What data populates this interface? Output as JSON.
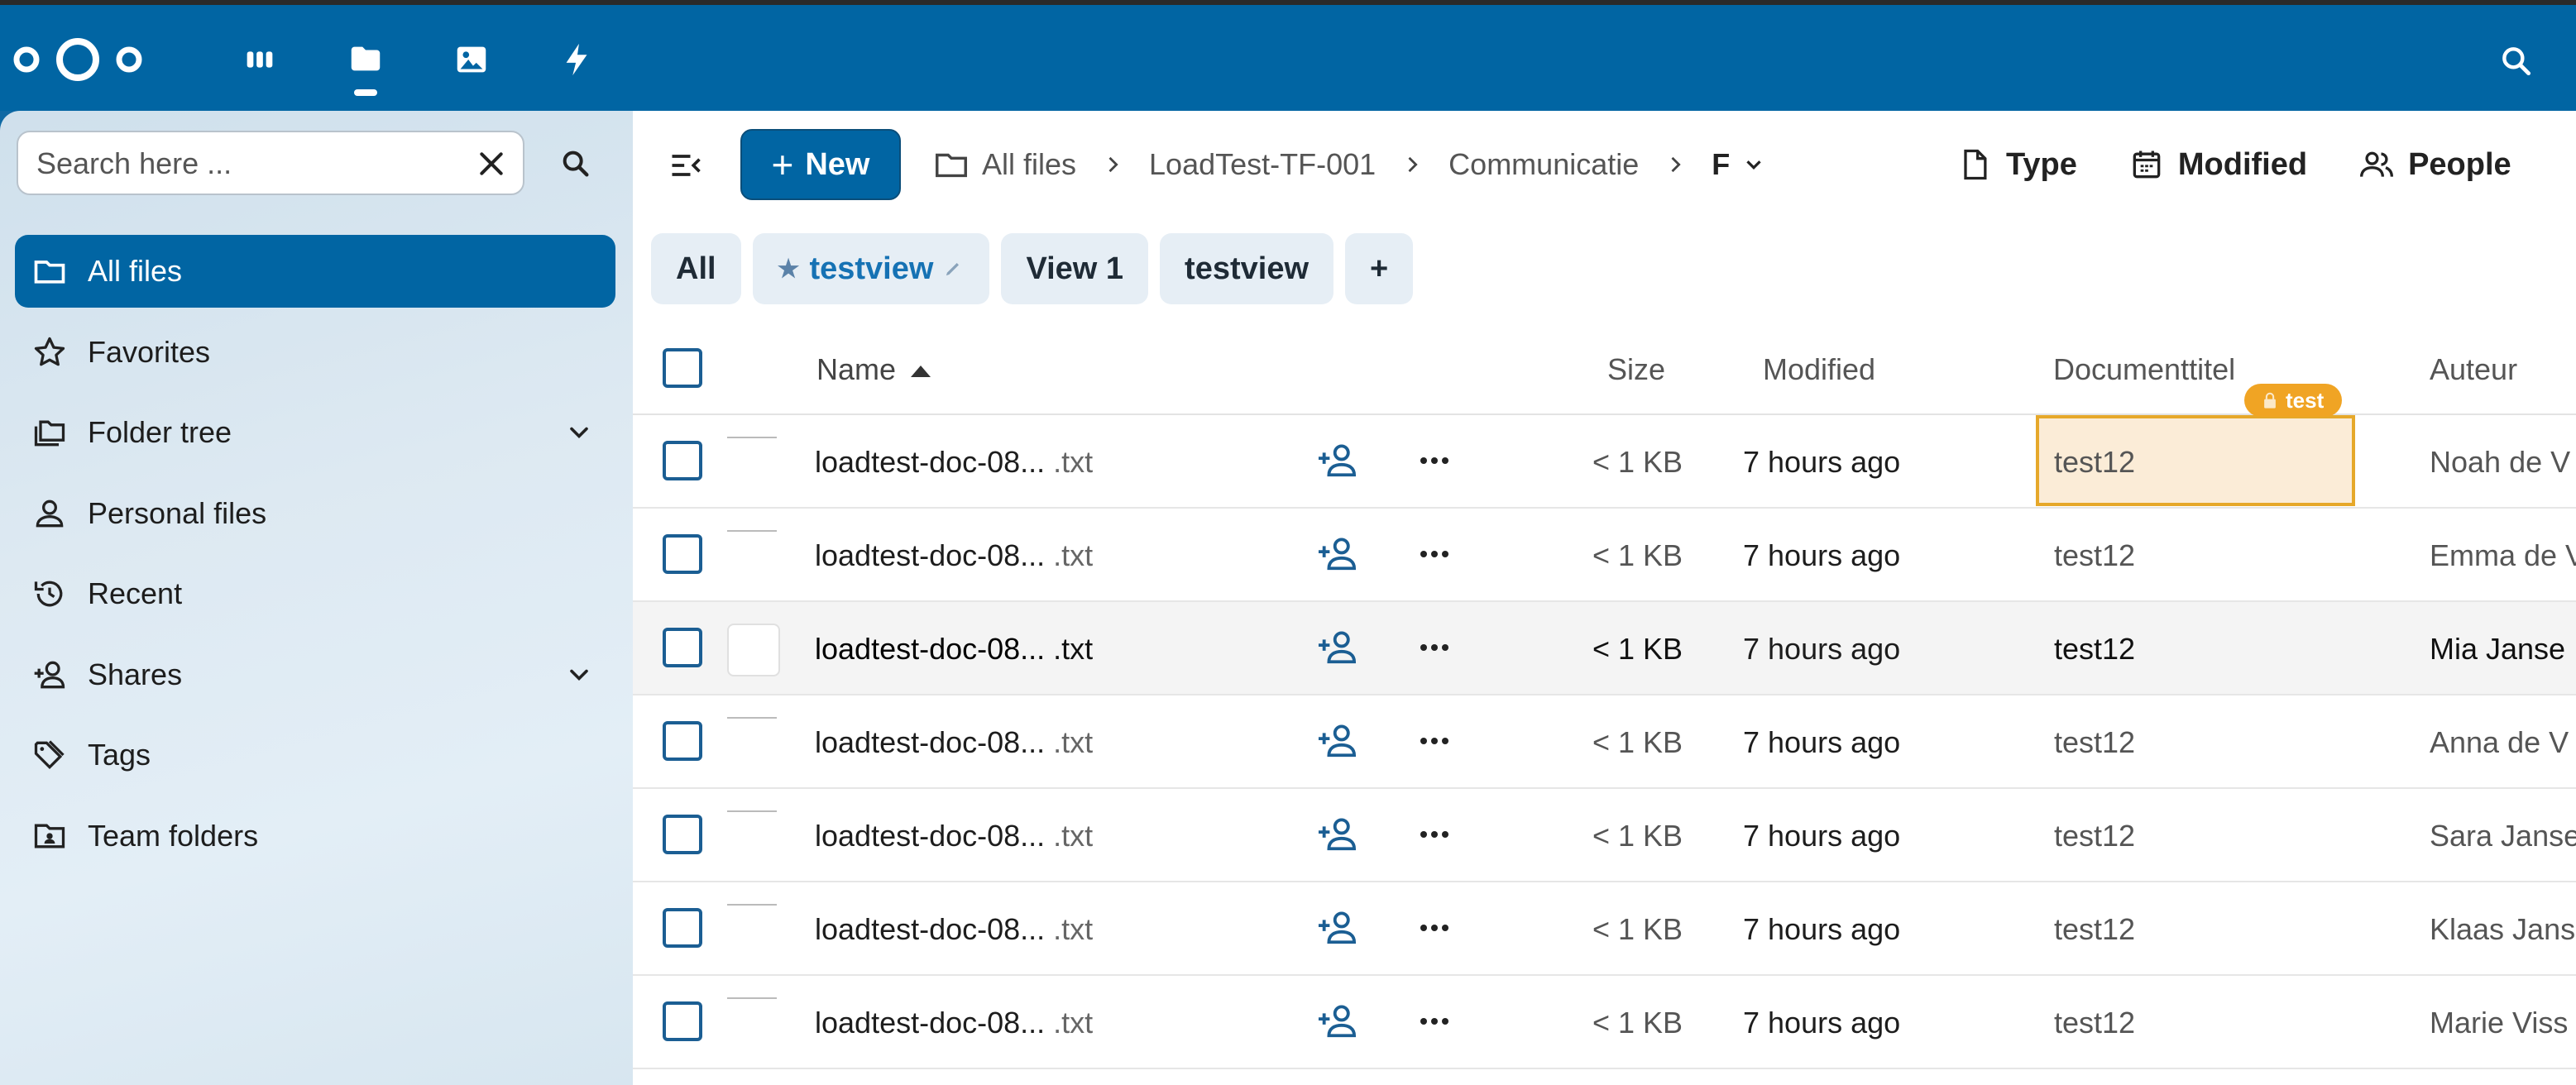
{
  "header": {
    "apps": [
      "dashboard-icon",
      "files-icon",
      "photos-icon",
      "activity-icon"
    ]
  },
  "sidebar": {
    "search_placeholder": "Search here ...",
    "items": [
      {
        "label": "All files",
        "icon": "folder-icon",
        "active": true
      },
      {
        "label": "Favorites",
        "icon": "star-icon"
      },
      {
        "label": "Folder tree",
        "icon": "folder-multiple-icon",
        "expandable": true
      },
      {
        "label": "Personal files",
        "icon": "account-icon"
      },
      {
        "label": "Recent",
        "icon": "history-icon"
      },
      {
        "label": "Shares",
        "icon": "account-plus-icon",
        "expandable": true
      },
      {
        "label": "Tags",
        "icon": "tag-multiple-icon"
      },
      {
        "label": "Team folders",
        "icon": "folder-account-icon"
      }
    ]
  },
  "toolbar": {
    "new_label": "New",
    "breadcrumbs": [
      "All files",
      "LoadTest-TF-001",
      "Communicatie",
      "F"
    ],
    "filters": [
      "Type",
      "Modified",
      "People"
    ]
  },
  "views": {
    "all": "All",
    "starred": "testview",
    "view1": "View 1",
    "view2": "testview",
    "add": "+"
  },
  "table": {
    "headers": {
      "name": "Name",
      "size": "Size",
      "modified": "Modified",
      "documenttitel": "Documenttitel",
      "auteur": "Auteur"
    },
    "badge": "test",
    "rows": [
      {
        "name": "loadtest-doc-08...",
        "ext": " .txt",
        "size": "< 1 KB",
        "modified": "7 hours ago",
        "doc": "test12",
        "author": "Noah de V"
      },
      {
        "name": "loadtest-doc-08...",
        "ext": " .txt",
        "size": "< 1 KB",
        "modified": "7 hours ago",
        "doc": "test12",
        "author": "Emma de V"
      },
      {
        "name": "loadtest-doc-08...",
        "ext": " .txt",
        "size": "< 1 KB",
        "modified": "7 hours ago",
        "doc": "test12",
        "author": "Mia Janse"
      },
      {
        "name": "loadtest-doc-08...",
        "ext": " .txt",
        "size": "< 1 KB",
        "modified": "7 hours ago",
        "doc": "test12",
        "author": "Anna de V"
      },
      {
        "name": "loadtest-doc-08...",
        "ext": " .txt",
        "size": "< 1 KB",
        "modified": "7 hours ago",
        "doc": "test12",
        "author": "Sara Janse"
      },
      {
        "name": "loadtest-doc-08...",
        "ext": " .txt",
        "size": "< 1 KB",
        "modified": "7 hours ago",
        "doc": "test12",
        "author": "Klaas Jans"
      },
      {
        "name": "loadtest-doc-08...",
        "ext": " .txt",
        "size": "< 1 KB",
        "modified": "7 hours ago",
        "doc": "test12",
        "author": "Marie Viss"
      }
    ]
  },
  "colors": {
    "primary": "#0165a3",
    "highlight": "#e6a82a",
    "highlight_bg": "#fbecd7"
  }
}
